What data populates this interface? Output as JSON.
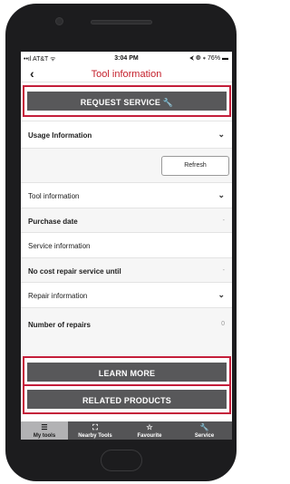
{
  "status": {
    "left": "••ıl AT&T ᯤ",
    "time": "3:04 PM",
    "right": "⮜ ◍ ∗ 76% ▬"
  },
  "nav": {
    "back_icon": "chevron-left-icon",
    "back_glyph": "‹",
    "title": "Tool information"
  },
  "request_service": {
    "label": "REQUEST SERVICE 🔧"
  },
  "usage": {
    "label": "Usage Information",
    "chevron": "⌄"
  },
  "refresh": {
    "label": "Refresh"
  },
  "sections": {
    "tool_information": "Tool information",
    "purchase_date": "Purchase date",
    "purchase_date_value": "-",
    "service_information": "Service information",
    "no_cost_repair": "No cost repair service until",
    "no_cost_repair_value": "-",
    "repair_information": "Repair information",
    "number_of_repairs": "Number of repairs",
    "number_of_repairs_value": "0"
  },
  "learn_more": {
    "label": "LEARN MORE"
  },
  "related_products": {
    "label": "RELATED PRODUCTS"
  },
  "tabs": [
    {
      "label": "My tools",
      "icon": "list-icon",
      "glyph": "☰"
    },
    {
      "label": "Nearby Tools",
      "icon": "locate-icon",
      "glyph": "⛶"
    },
    {
      "label": "Favourite",
      "icon": "star-icon",
      "glyph": "☆"
    },
    {
      "label": "Service",
      "icon": "wrench-icon",
      "glyph": "🔧"
    }
  ],
  "colors": {
    "accent": "#c41e2a",
    "button": "#58585a",
    "tab_active": "#b2b2b4"
  }
}
